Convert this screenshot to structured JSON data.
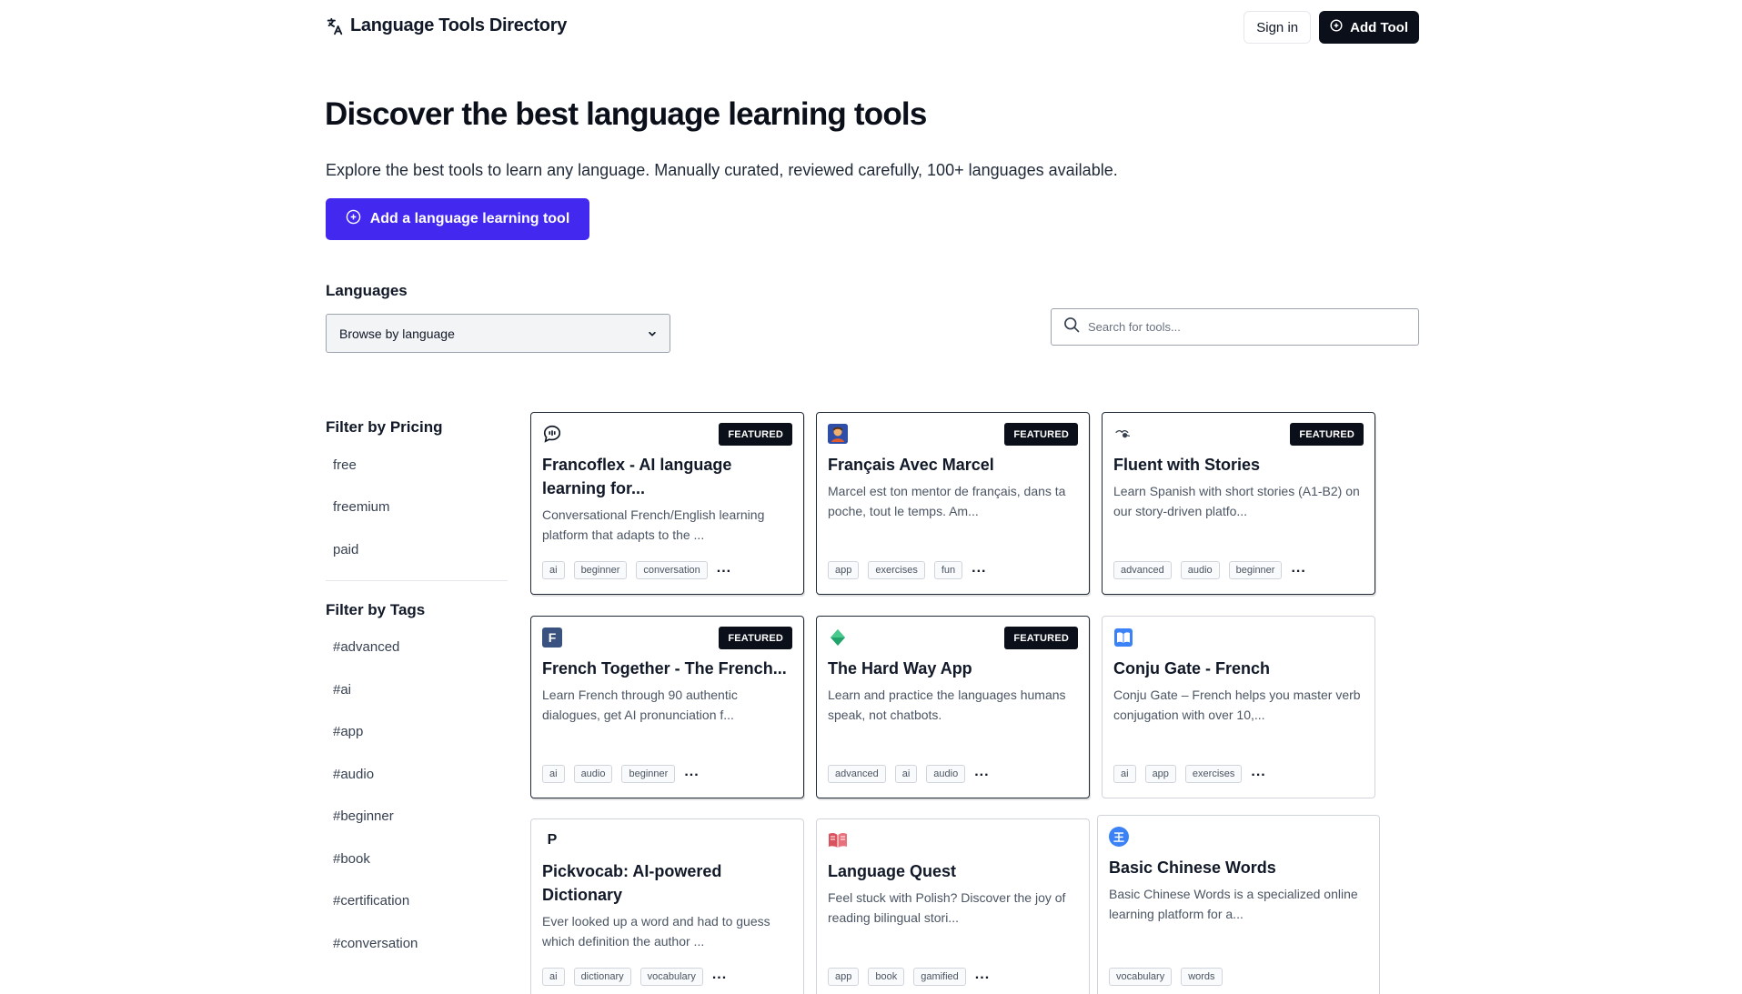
{
  "header": {
    "logo_text": "Language Tools Directory",
    "sign_in": "Sign in",
    "add_tool": "Add Tool"
  },
  "hero": {
    "title": "Discover the best language learning tools",
    "subtitle": "Explore the best tools to learn any language. Manually curated, reviewed carefully, 100+ languages available.",
    "cta": "Add a language learning tool"
  },
  "filters": {
    "languages_label": "Languages",
    "language_select": "Browse by language",
    "search_placeholder": "Search for tools..."
  },
  "sidebar": {
    "pricing_heading": "Filter by Pricing",
    "pricing": [
      "free",
      "freemium",
      "paid"
    ],
    "tags_heading": "Filter by Tags",
    "tags": [
      "#advanced",
      "#ai",
      "#app",
      "#audio",
      "#beginner",
      "#book",
      "#certification",
      "#conversation"
    ]
  },
  "cards": [
    {
      "title": "Francoflex - AI language learning for...",
      "desc": "Conversational French/English learning platform that adapts to the ...",
      "featured": "FEATURED",
      "tags": [
        "ai",
        "beginner",
        "conversation"
      ],
      "more": "...",
      "icon": "chat-bubble-icon"
    },
    {
      "title": "Français Avec Marcel",
      "desc": "Marcel est ton mentor de français, dans ta poche, tout le temps. Am...",
      "featured": "FEATURED",
      "tags": [
        "app",
        "exercises",
        "fun"
      ],
      "more": "...",
      "icon": "marcel-avatar-icon"
    },
    {
      "title": "Fluent with Stories",
      "desc": "Learn Spanish with short stories (A1-B2) on our story-driven platfo...",
      "featured": "FEATURED",
      "tags": [
        "advanced",
        "audio",
        "beginner"
      ],
      "more": "...",
      "icon": "bird-icon"
    },
    {
      "title": "French Together - The French...",
      "desc": "Learn French through 90 authentic dialogues, get AI pronunciation f...",
      "featured": "FEATURED",
      "tags": [
        "ai",
        "audio",
        "beginner"
      ],
      "more": "...",
      "icon": "letter-f-icon",
      "icon_letter": "F"
    },
    {
      "title": "The Hard Way App",
      "desc": "Learn and practice the languages humans speak, not chatbots.",
      "featured": "FEATURED",
      "tags": [
        "advanced",
        "ai",
        "audio"
      ],
      "more": "...",
      "icon": "green-diamond-icon"
    },
    {
      "title": "Conju Gate - French",
      "desc": "Conju Gate – French helps you master verb conjugation with over 10,...",
      "featured": "",
      "tags": [
        "ai",
        "app",
        "exercises"
      ],
      "more": "...",
      "icon": "open-book-icon"
    },
    {
      "title": "Pickvocab: AI-powered Dictionary",
      "desc": "Ever looked up a word and had to guess which definition the author ...",
      "featured": "",
      "tags": [
        "ai",
        "dictionary",
        "vocabulary"
      ],
      "more": "...",
      "icon": "letter-p-icon",
      "icon_letter": "P"
    },
    {
      "title": "Language Quest",
      "desc": "Feel stuck with Polish? Discover the joy of reading bilingual stori...",
      "featured": "",
      "tags": [
        "app",
        "book",
        "gamified"
      ],
      "more": "...",
      "icon": "red-book-icon"
    },
    {
      "title": "Basic Chinese Words",
      "desc": "Basic Chinese Words is a specialized online learning platform for a...",
      "featured": "",
      "tags": [
        "vocabulary",
        "words"
      ],
      "more": "",
      "icon": "chinese-character-icon",
      "icon_letter": "王"
    }
  ],
  "colors": {
    "primary": "#4328f0",
    "dark": "#0b0f19",
    "border": "#d1d5db",
    "hard_way_green": "#22a36b",
    "basic_chinese_blue": "#3b82f6"
  }
}
